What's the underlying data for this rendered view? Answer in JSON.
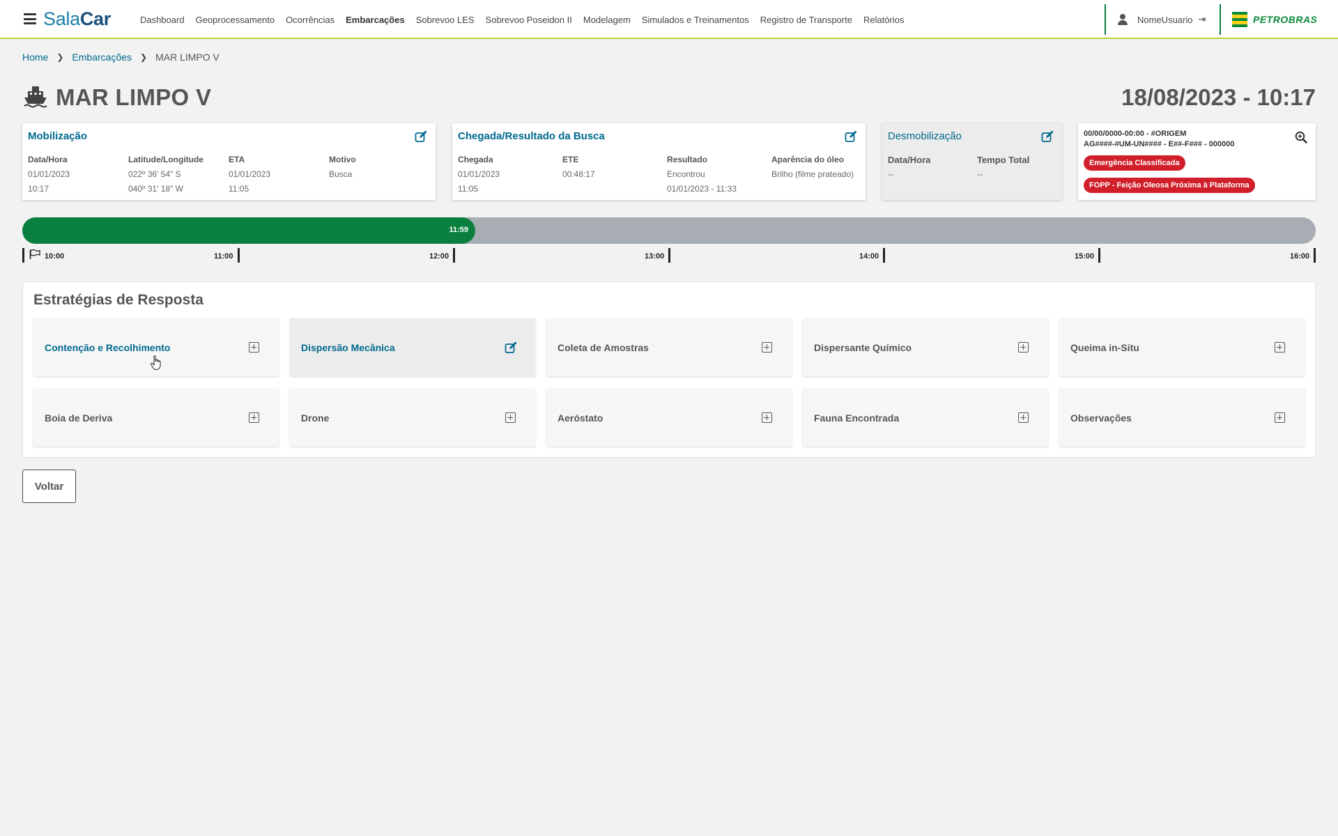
{
  "app": {
    "logo_part1": "Sala",
    "logo_part2": "Car"
  },
  "nav": [
    {
      "label": "Dashboard",
      "active": false
    },
    {
      "label": "Geoprocessamento",
      "active": false
    },
    {
      "label": "Ocorrências",
      "active": false
    },
    {
      "label": "Embarcações",
      "active": true
    },
    {
      "label": "Sobrevoo LES",
      "active": false
    },
    {
      "label": "Sobrevoo Poseidon II",
      "active": false
    },
    {
      "label": "Modelagem",
      "active": false
    },
    {
      "label": "Simulados e Treinamentos",
      "active": false
    },
    {
      "label": "Registro de Transporte",
      "active": false
    },
    {
      "label": "Relatórios",
      "active": false
    }
  ],
  "user": {
    "name": "NomeUsuario",
    "logout_icon": "⇥"
  },
  "brand": {
    "name": "PETROBRAS"
  },
  "breadcrumb": {
    "home": "Home",
    "section": "Embarcações",
    "current": "MAR LIMPO V"
  },
  "page": {
    "title": "MAR LIMPO V",
    "datetime": "18/08/2023 - 10:17"
  },
  "mobilizacao": {
    "title": "Mobilização",
    "cols": [
      {
        "label": "Data/Hora",
        "line1": "01/01/2023",
        "line2": "10:17"
      },
      {
        "label": "Latitude/Longitude",
        "line1": "022º 36' 54\" S",
        "line2": "040º 31' 18\" W"
      },
      {
        "label": "ETA",
        "line1": "01/01/2023",
        "line2": "11:05"
      },
      {
        "label": "Motivo",
        "line1": "Busca",
        "line2": ""
      }
    ]
  },
  "chegada": {
    "title": "Chegada/Resultado da Busca",
    "cols": [
      {
        "label": "Chegada",
        "line1": "01/01/2023",
        "line2": "11:05",
        "line3": ""
      },
      {
        "label": "ETE",
        "line1": "00:48:17",
        "line2": "",
        "line3": ""
      },
      {
        "label": "Resultado",
        "line1": "Encontrou",
        "line2": "01/01/2023 - 11:33",
        "line3": ""
      },
      {
        "label": "Aparência do óleo",
        "line1": "Brilho (filme prateado)",
        "line2": "",
        "line3": ""
      }
    ]
  },
  "desmobilizacao": {
    "title": "Desmobilização",
    "cols": [
      {
        "label": "Data/Hora",
        "value": "--"
      },
      {
        "label": "Tempo Total",
        "value": "--"
      }
    ]
  },
  "ocorrencia": {
    "line1": "00/00/0000-00:00 - #ORIGEM",
    "line2": "AG####-#UM-UN#### - E##-F### - 000000",
    "badges": [
      "Emergência Classificada",
      "FOPP - Feição Oleosa Próxima à Plataforma"
    ],
    "badge_color": "#d11f2a"
  },
  "timeline": {
    "current_label": "11:59",
    "progress_fraction": 0.35,
    "ticks": [
      "10:00",
      "11:00",
      "12:00",
      "13:00",
      "14:00",
      "15:00",
      "16:00"
    ],
    "fill_color": "#0a8040",
    "track_color": "#a8adb4"
  },
  "estrategias": {
    "title": "Estratégias de Resposta",
    "items": [
      {
        "label": "Contenção e Recolhimento",
        "icon": "plus-square-icon",
        "highlight": true
      },
      {
        "label": "Dispersão Mecânica",
        "icon": "edit-icon",
        "highlight": true
      },
      {
        "label": "Coleta de Amostras",
        "icon": "plus-square-icon",
        "highlight": false
      },
      {
        "label": "Dispersante Químico",
        "icon": "plus-square-icon",
        "highlight": false
      },
      {
        "label": "Queima in-Situ",
        "icon": "plus-square-icon",
        "highlight": false
      },
      {
        "label": "Boia de Deriva",
        "icon": "plus-square-icon",
        "highlight": false
      },
      {
        "label": "Drone",
        "icon": "plus-square-icon",
        "highlight": false
      },
      {
        "label": "Aeróstato",
        "icon": "plus-square-icon",
        "highlight": false
      },
      {
        "label": "Fauna Encontrada",
        "icon": "plus-square-icon",
        "highlight": false
      },
      {
        "label": "Observações",
        "icon": "plus-square-icon",
        "highlight": false
      }
    ]
  },
  "actions": {
    "back": "Voltar"
  },
  "colors": {
    "accent_blue": "#00698f",
    "brand_green": "#0a8a3a",
    "brand_yellow": "#f7d117"
  }
}
